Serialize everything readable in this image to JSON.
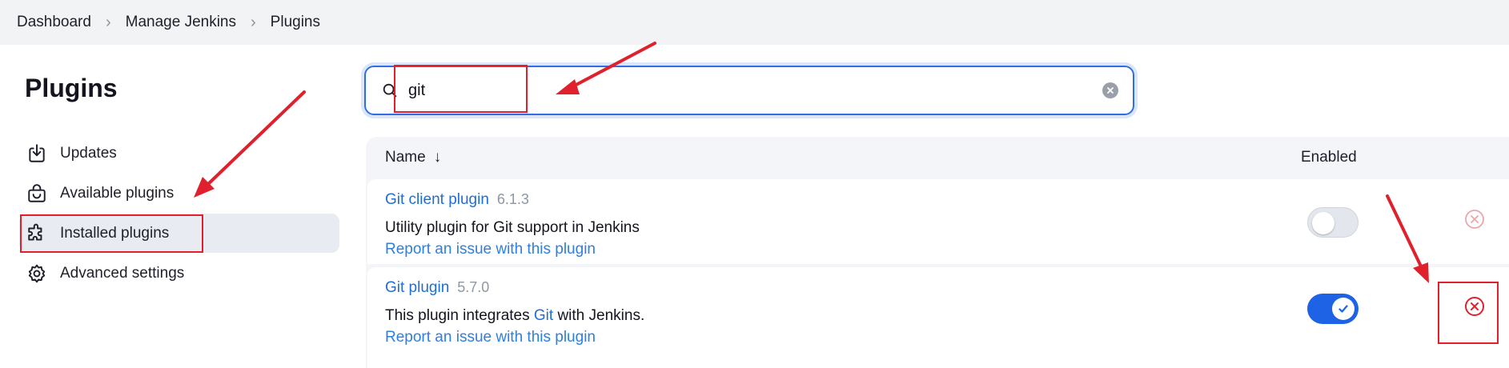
{
  "breadcrumb": [
    "Dashboard",
    "Manage Jenkins",
    "Plugins"
  ],
  "sidebar": {
    "title": "Plugins",
    "items": [
      {
        "label": "Updates",
        "icon": "download-icon"
      },
      {
        "label": "Available plugins",
        "icon": "shopping-bag-icon"
      },
      {
        "label": "Installed plugins",
        "icon": "puzzle-icon",
        "active": true
      },
      {
        "label": "Advanced settings",
        "icon": "gear-icon"
      }
    ]
  },
  "search": {
    "value": "git",
    "placeholder": ""
  },
  "table": {
    "headers": {
      "name": "Name",
      "sort_indicator": "↓",
      "enabled": "Enabled"
    },
    "rows": [
      {
        "name": "Git client plugin",
        "version": "6.1.3",
        "description": "Utility plugin for Git support in Jenkins",
        "report_link": "Report an issue with this plugin",
        "enabled": false
      },
      {
        "name": "Git plugin",
        "version": "5.7.0",
        "description_before": "This plugin integrates ",
        "description_link": "Git",
        "description_after": " with Jenkins.",
        "report_link": "Report an issue with this plugin",
        "enabled": true
      }
    ]
  },
  "colors": {
    "accent": "#1e63e6",
    "link": "#1f6ed4",
    "annotation": "#e0212d"
  }
}
